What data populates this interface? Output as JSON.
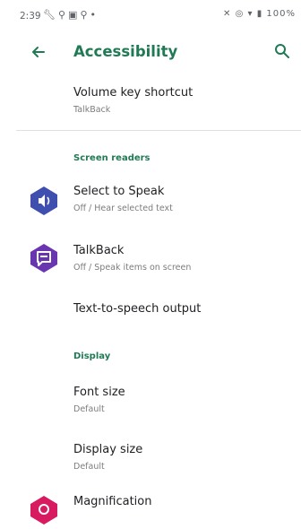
{
  "status_bar": {
    "time": "2:39",
    "left_icons": [
      "wrench-icon",
      "location-icon",
      "gallery-icon",
      "location-icon",
      "dot-icon"
    ],
    "right_icons": [
      "mute-icon",
      "data-saver-icon",
      "wifi-icon",
      "battery-icon"
    ],
    "battery": "100%"
  },
  "app_bar": {
    "title": "Accessibility",
    "back_icon": "arrow-back-icon",
    "search_icon": "search-icon"
  },
  "items": {
    "volume_key": {
      "title": "Volume key shortcut",
      "subtitle": "TalkBack"
    },
    "select_to_speak": {
      "title": "Select to Speak",
      "subtitle": "Off / Hear selected text",
      "icon": "select-to-speak-icon",
      "icon_color": "#3f4fb0"
    },
    "talkback": {
      "title": "TalkBack",
      "subtitle": "Off / Speak items on screen",
      "icon": "talkback-icon",
      "icon_color": "#6a35b0"
    },
    "tts": {
      "title": "Text-to-speech output"
    },
    "font_size": {
      "title": "Font size",
      "subtitle": "Default"
    },
    "display_size": {
      "title": "Display size",
      "subtitle": "Default"
    },
    "magnification": {
      "title": "Magnification",
      "icon": "magnification-icon",
      "icon_color": "#d81b60"
    }
  },
  "sections": {
    "screen_readers": "Screen readers",
    "display": "Display"
  },
  "colors": {
    "accent": "#1f7a55",
    "text": "#202124",
    "subtext": "#7c7c7c"
  }
}
